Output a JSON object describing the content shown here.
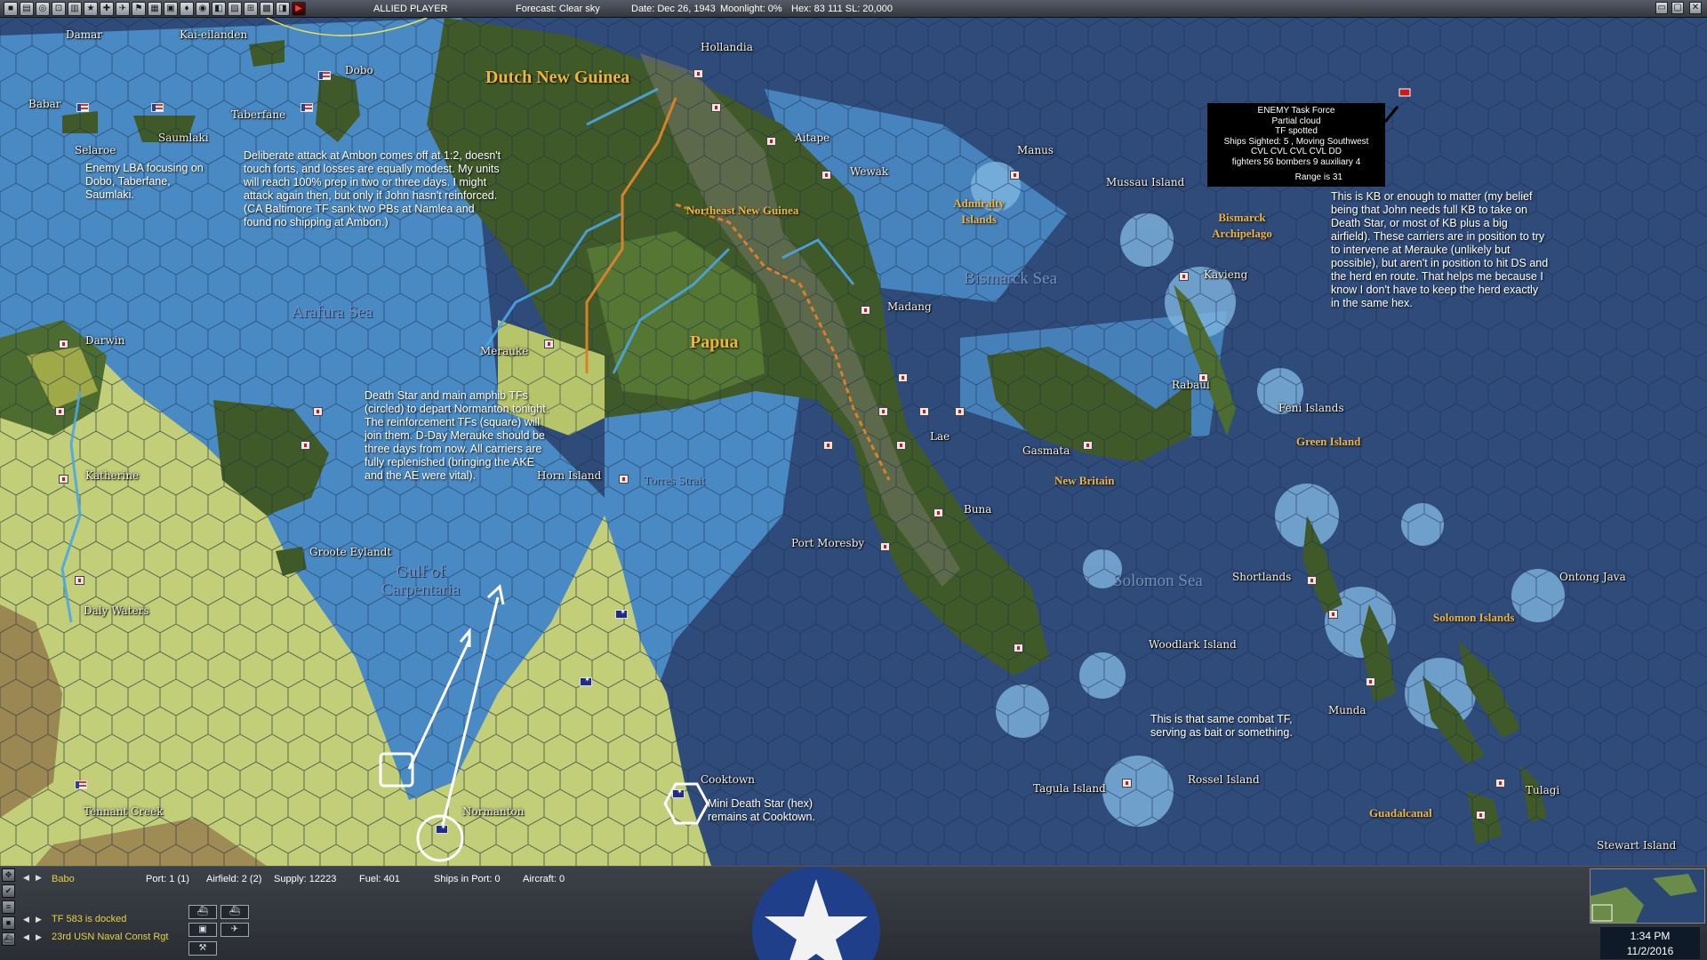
{
  "topbar": {
    "side": "ALLIED PLAYER",
    "forecast": "Forecast: Clear sky",
    "date": "Date: Dec 26, 1943",
    "moonlight": "Moonlight: 0%",
    "hex": "Hex: 83 111  SL: 20,000",
    "tool_icons": [
      "■",
      "▤",
      "◎",
      "⊡",
      "▥",
      "★",
      "✚",
      "✈",
      "⚑",
      "▦",
      "▣",
      "♦",
      "◉",
      "◧",
      "▨",
      "⊞",
      "▩",
      "◨"
    ],
    "window_buttons": [
      "▭",
      "▢",
      "✕"
    ]
  },
  "map": {
    "places": [
      {
        "id": "damar",
        "label": "Damar"
      },
      {
        "id": "kai",
        "label": "Kai-eilanden"
      },
      {
        "id": "babar",
        "label": "Babar"
      },
      {
        "id": "dobo",
        "label": "Dobo"
      },
      {
        "id": "taberfane",
        "label": "Taberfane"
      },
      {
        "id": "saumlaki",
        "label": "Saumlaki"
      },
      {
        "id": "selaroe",
        "label": "Selaroe"
      },
      {
        "id": "hollandia",
        "label": "Hollandia"
      },
      {
        "id": "aitape",
        "label": "Aitape"
      },
      {
        "id": "wewak",
        "label": "Wewak"
      },
      {
        "id": "manus",
        "label": "Manus"
      },
      {
        "id": "mussau",
        "label": "Mussau Island"
      },
      {
        "id": "kavieng",
        "label": "Kavieng"
      },
      {
        "id": "madang",
        "label": "Madang"
      },
      {
        "id": "darwin",
        "label": "Darwin"
      },
      {
        "id": "merauke",
        "label": "Merauke"
      },
      {
        "id": "rabaul",
        "label": "Rabaul"
      },
      {
        "id": "feni",
        "label": "Feni Islands"
      },
      {
        "id": "lae",
        "label": "Lae"
      },
      {
        "id": "gasmata",
        "label": "Gasmata"
      },
      {
        "id": "katherine",
        "label": "Katherine"
      },
      {
        "id": "horn",
        "label": "Horn Island"
      },
      {
        "id": "buna",
        "label": "Buna"
      },
      {
        "id": "portmoresby",
        "label": "Port Moresby"
      },
      {
        "id": "groote",
        "label": "Groote Eylandt"
      },
      {
        "id": "shortlands",
        "label": "Shortlands"
      },
      {
        "id": "ontong",
        "label": "Ontong Java"
      },
      {
        "id": "dalywaters",
        "label": "Daly Waters"
      },
      {
        "id": "woodlark",
        "label": "Woodlark Island"
      },
      {
        "id": "munda",
        "label": "Munda"
      },
      {
        "id": "cooktown",
        "label": "Cooktown"
      },
      {
        "id": "rossel",
        "label": "Rossel Island"
      },
      {
        "id": "tagula",
        "label": "Tagula Island"
      },
      {
        "id": "tulagi",
        "label": "Tulagi"
      },
      {
        "id": "tennant",
        "label": "Tennant Creek"
      },
      {
        "id": "normanton",
        "label": "Normanton"
      },
      {
        "id": "stewart",
        "label": "Stewart Island"
      }
    ],
    "regions": [
      {
        "id": "dng",
        "label": "Dutch New Guinea"
      },
      {
        "id": "nng",
        "label": "Northeast New Guinea"
      },
      {
        "id": "admiralty",
        "label": "Admiralty Islands"
      },
      {
        "id": "bismarck_arch",
        "label": "Bismarck Archipelago"
      },
      {
        "id": "papua",
        "label": "Papua"
      },
      {
        "id": "newbritain",
        "label": "New Britain"
      },
      {
        "id": "green",
        "label": "Green Island"
      },
      {
        "id": "solomon_is",
        "label": "Solomon Islands"
      },
      {
        "id": "guadalcanal",
        "label": "Guadalcanal"
      }
    ],
    "seas": [
      {
        "id": "arafura",
        "label": "Arafura Sea"
      },
      {
        "id": "bismarck_sea",
        "label": "Bismarck Sea"
      },
      {
        "id": "torres",
        "label": "Torres Strait"
      },
      {
        "id": "carpentaria",
        "label": "Gulf of Carpentaria"
      },
      {
        "id": "solomon_sea",
        "label": "Solomon Sea"
      }
    ],
    "notes": {
      "lba": "Enemy LBA focusing on Dobo, Taberfane, Saumlaki.",
      "ambon": "Deliberate attack at Ambon comes off at 1:2, doesn't touch forts, and losses are equally modest.  My units will reach 100% prep in two or three days.  I might attack again then, but only if John hasn't reinforced.  (CA Baltimore TF sank two PBs at Namlea and found no shipping at Ambon.)",
      "deathstar": "Death Star and main amphib TFs (circled) to depart Normanton tonight.  The reinforcement TFs (square) will join them.  D-Day Merauke should be three days from now.  All carriers are fully replenished (bringing the AKE and the AE were vital).",
      "kb": "This is KB or enough to matter (my belief being that John needs full KB to take on Death Star, or most of KB plus a big airfield).  These carriers are in position to try to intervene at Merauke (unlikely but possible), but aren't in position to hit DS and the herd en route.  That helps me because I know I don't have to keep the herd exactly in the same hex.",
      "bait": "This is that same combat TF, serving as bait or something.",
      "mini": "Mini Death Star (hex) remains at Cooktown."
    },
    "enemy_popup": {
      "lines": [
        "ENEMY Task Force",
        "Partial cloud",
        "TF spotted",
        "Ships Sighted: 5 , Moving Southwest",
        "CVL CVL CVL CVL DD",
        "fighters 56  bombers 9  auxiliary 4"
      ],
      "range": "Range is 31"
    },
    "colors": {
      "sea_deep": "#2f4b7a",
      "sea_shallow": "#4b8ac4",
      "coast": "#7eb5e0",
      "australia": "#c2cf78",
      "jungle": "#3f5a28",
      "overlay": "#ffffff"
    }
  },
  "bottom": {
    "location": "Babo",
    "port": "Port: 1 (1)",
    "airfield": "Airfield: 2 (2)",
    "supply": "Supply: 12223",
    "fuel": "Fuel: 401",
    "ships": "Ships in Port: 0",
    "aircraft": "Aircraft: 0",
    "tf": "TF 583 is docked",
    "unit": "23rd USN Naval Const Rgt",
    "icon_row1": [
      "⛴",
      "⛴"
    ],
    "icon_row2": [
      "▣",
      "✈"
    ],
    "icon_row3": [
      "⚒"
    ],
    "time": "1:34 PM",
    "date": "11/2/2016",
    "emblem_color": "#1f3f8a"
  }
}
